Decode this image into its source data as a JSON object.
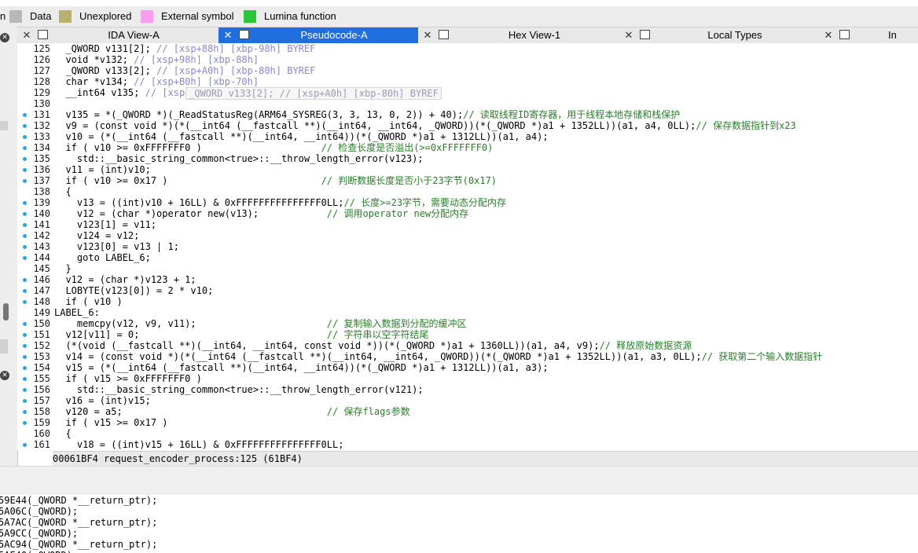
{
  "legend": {
    "items": [
      {
        "label": "n",
        "color": ""
      },
      {
        "label": "Data",
        "color": "#b8b8b8"
      },
      {
        "label": "Unexplored",
        "color": "#b8b070"
      },
      {
        "label": "External symbol",
        "color": "#ff9cf0"
      },
      {
        "label": "Lumina function",
        "color": "#2cc63a"
      }
    ]
  },
  "tabs": [
    {
      "label": "IDA View-A",
      "icon": "text-view-icon",
      "active": false
    },
    {
      "label": "Pseudocode-A",
      "icon": "pseudocode-icon",
      "active": true
    },
    {
      "label": "Hex View-1",
      "icon": "hex-icon",
      "active": false
    },
    {
      "label": "Local Types",
      "icon": "types-icon",
      "active": false
    },
    {
      "label": "In",
      "icon": "structures-icon",
      "active": false
    }
  ],
  "tooltip": "_QWORD v133[2]; // [xsp+A0h] [xbp-80h] BYREF",
  "code_lines": [
    {
      "ln": "125",
      "dot": false,
      "code": "  _QWORD v131[2]; ",
      "comment": "// [xsp+88h] [xbp-98h] BYREF"
    },
    {
      "ln": "126",
      "dot": false,
      "code": "  void *v132; ",
      "comment": "// [xsp+98h] [xbp-88h]"
    },
    {
      "ln": "127",
      "dot": false,
      "code": "  _QWORD v133[2]; ",
      "comment": "// [xsp+A0h] [xbp-80h] BYREF"
    },
    {
      "ln": "128",
      "dot": false,
      "code": "  char *v134; ",
      "comment": "// [xsp+B0h] [xbp-70h]"
    },
    {
      "ln": "129",
      "dot": false,
      "code": "  __int64 v135; ",
      "comment": "// [xsp+B8h] [xbp-68h]"
    },
    {
      "ln": "130",
      "dot": false,
      "code": "",
      "comment": ""
    },
    {
      "ln": "131",
      "dot": true,
      "code": "  v135 = *(_QWORD *)(_ReadStatusReg(ARM64_SYSREG(3, 3, 13, 0, 2)) + 40);",
      "comment": "// 读取线程ID寄存器，用于线程本地存储和栈保护"
    },
    {
      "ln": "132",
      "dot": true,
      "code": "  v9 = (const void *)(*(__int64 (__fastcall **)(__int64, __int64, _QWORD))(*(_QWORD *)a1 + 1352LL))(a1, a4, 0LL);",
      "comment": "// 保存数据指针到x23"
    },
    {
      "ln": "133",
      "dot": true,
      "code": "  v10 = (*(__int64 (__fastcall **)(__int64, __int64))(*(_QWORD *)a1 + 1312LL))(a1, a4);",
      "comment": ""
    },
    {
      "ln": "134",
      "dot": true,
      "code": "  if ( v10 >= 0xFFFFFFF0 )                     ",
      "comment": "// 检查长度是否溢出(>=0xFFFFFFF0)"
    },
    {
      "ln": "135",
      "dot": true,
      "code": "    std::__basic_string_common<true>::__throw_length_error(v123);",
      "comment": ""
    },
    {
      "ln": "136",
      "dot": true,
      "code": "  v11 = (int)v10;",
      "comment": ""
    },
    {
      "ln": "137",
      "dot": true,
      "code": "  if ( v10 >= 0x17 )                           ",
      "comment": "// 判断数据长度是否小于23字节(0x17)"
    },
    {
      "ln": "138",
      "dot": false,
      "code": "  {",
      "comment": ""
    },
    {
      "ln": "139",
      "dot": true,
      "code": "    v13 = ((int)v10 + 16LL) & 0xFFFFFFFFFFFFFFF0LL;",
      "comment": "// 长度>=23字节，需要动态分配内存"
    },
    {
      "ln": "140",
      "dot": true,
      "code": "    v12 = (char *)operator new(v13);            ",
      "comment": "// 调用operator new分配内存"
    },
    {
      "ln": "141",
      "dot": true,
      "code": "    v123[1] = v11;",
      "comment": ""
    },
    {
      "ln": "142",
      "dot": true,
      "code": "    v124 = v12;",
      "comment": ""
    },
    {
      "ln": "143",
      "dot": true,
      "code": "    v123[0] = v13 | 1;",
      "comment": ""
    },
    {
      "ln": "144",
      "dot": true,
      "code": "    goto LABEL_6;",
      "comment": ""
    },
    {
      "ln": "145",
      "dot": false,
      "code": "  }",
      "comment": ""
    },
    {
      "ln": "146",
      "dot": true,
      "code": "  v12 = (char *)v123 + 1;",
      "comment": ""
    },
    {
      "ln": "147",
      "dot": true,
      "code": "  LOBYTE(v123[0]) = 2 * v10;",
      "comment": ""
    },
    {
      "ln": "148",
      "dot": true,
      "code": "  if ( v10 )",
      "comment": ""
    },
    {
      "ln": "149",
      "dot": false,
      "code": "LABEL_6:",
      "comment": ""
    },
    {
      "ln": "150",
      "dot": true,
      "code": "    memcpy(v12, v9, v11);                       ",
      "comment": "// 复制输入数据到分配的缓冲区"
    },
    {
      "ln": "151",
      "dot": true,
      "code": "  v12[v11] = 0;                                 ",
      "comment": "// 字符串以空字符结尾"
    },
    {
      "ln": "152",
      "dot": true,
      "code": "  (*(void (__fastcall **)(__int64, __int64, const void *))(*(_QWORD *)a1 + 1360LL))(a1, a4, v9);",
      "comment": "// 释放原始数据资源"
    },
    {
      "ln": "153",
      "dot": true,
      "code": "  v14 = (const void *)(*(__int64 (__fastcall **)(__int64, __int64, _QWORD))(*(_QWORD *)a1 + 1352LL))(a1, a3, 0LL);",
      "comment": "// 获取第二个输入数据指针"
    },
    {
      "ln": "154",
      "dot": true,
      "code": "  v15 = (*(__int64 (__fastcall **)(__int64, __int64))(*(_QWORD *)a1 + 1312LL))(a1, a3);",
      "comment": ""
    },
    {
      "ln": "155",
      "dot": true,
      "code": "  if ( v15 >= 0xFFFFFFF0 )",
      "comment": ""
    },
    {
      "ln": "156",
      "dot": true,
      "code": "    std::__basic_string_common<true>::__throw_length_error(v121);",
      "comment": ""
    },
    {
      "ln": "157",
      "dot": true,
      "code": "  v16 = (int)v15;",
      "comment": ""
    },
    {
      "ln": "158",
      "dot": true,
      "code": "  v120 = a5;                                    ",
      "comment": "// 保存flags参数"
    },
    {
      "ln": "159",
      "dot": true,
      "code": "  if ( v15 >= 0x17 )",
      "comment": ""
    },
    {
      "ln": "160",
      "dot": false,
      "code": "  {",
      "comment": ""
    },
    {
      "ln": "161",
      "dot": true,
      "code": "    v18 = ((int)v15 + 16LL) & 0xFFFFFFFFFFFFFFF0LL;",
      "comment": ""
    }
  ],
  "status_bar": "00061BF4 request_encoder_process:125 (61BF4)",
  "bottom_lines": [
    "59E44(_QWORD *__return_ptr);",
    "5A06C(_QWORD);",
    "5A7AC(_QWORD *__return_ptr);",
    "5A9CC(_QWORD);",
    "5AC94(_QWORD *__return_ptr);",
    "5AE40(_QWORD);"
  ]
}
